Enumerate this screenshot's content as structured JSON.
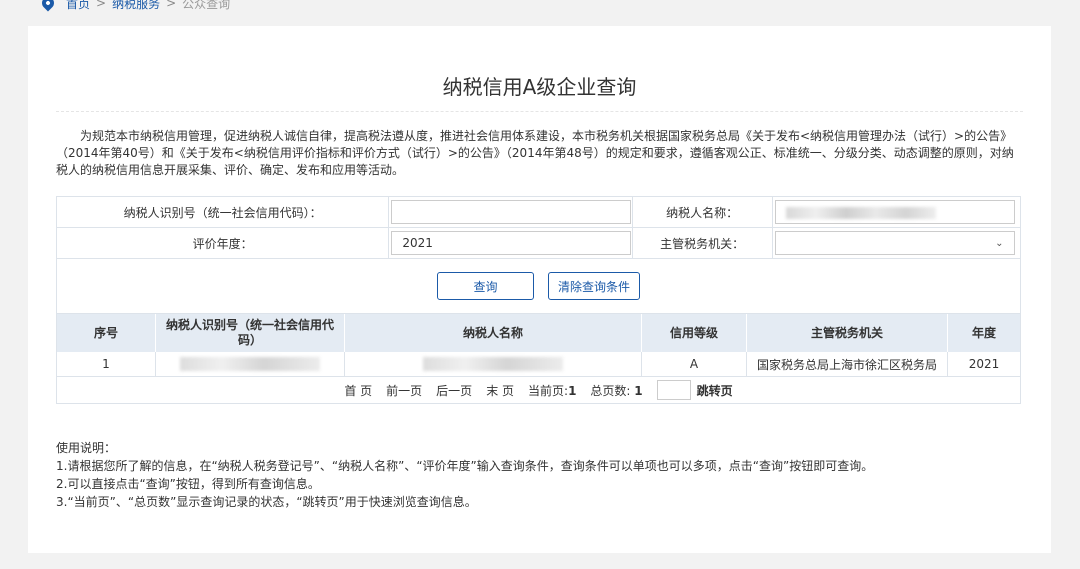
{
  "breadcrumb": {
    "home": "首页",
    "sep": ">",
    "service": "纳税服务",
    "current": "公众查询"
  },
  "page": {
    "title": "纳税信用A级企业查询",
    "intro": "为规范本市纳税信用管理，促进纳税人诚信自律，提高税法遵从度，推进社会信用体系建设，本市税务机关根据国家税务总局《关于发布<纳税信用管理办法（试行）>的公告》（2014年第40号）和《关于发布<纳税信用评价指标和评价方式（试行）>的公告》（2014年第48号）的规定和要求，遵循客观公正、标准统一、分级分类、动态调整的原则，对纳税人的纳税信用信息开展采集、评价、确定、发布和应用等活动。"
  },
  "form": {
    "taxpayer_id_label": "纳税人识别号（统一社会信用代码）：",
    "taxpayer_id_value": "",
    "taxpayer_name_label": "纳税人名称：",
    "year_label": "评价年度：",
    "year_value": "2021",
    "authority_label": "主管税务机关：",
    "authority_value": "",
    "query_button": "查询",
    "clear_button": "清除查询条件"
  },
  "table": {
    "headers": [
      "序号",
      "纳税人识别号（统一社会信用代码）",
      "纳税人名称",
      "信用等级",
      "主管税务机关",
      "年度"
    ],
    "rows": [
      {
        "index": "1",
        "credit_level": "A",
        "authority": "国家税务总局上海市徐汇区税务局",
        "year": "2021"
      }
    ]
  },
  "pager": {
    "first": "首 页",
    "prev": "前一页",
    "next": "后一页",
    "last": "末 页",
    "current_label": "当前页:",
    "current_value": "1",
    "total_label": "总页数:",
    "total_value": "1",
    "jump_label": "跳转页"
  },
  "usage": {
    "title": "使用说明：",
    "line1": "1.请根据您所了解的信息，在“纳税人税务登记号”、“纳税人名称”、“评价年度”输入查询条件，查询条件可以单项也可以多项，点击“查询”按钮即可查询。",
    "line2": "2.可以直接点击“查询”按钮，得到所有查询信息。",
    "line3": "3.“当前页”、“总页数”显示查询记录的状态，“跳转页”用于快速浏览查询信息。"
  }
}
